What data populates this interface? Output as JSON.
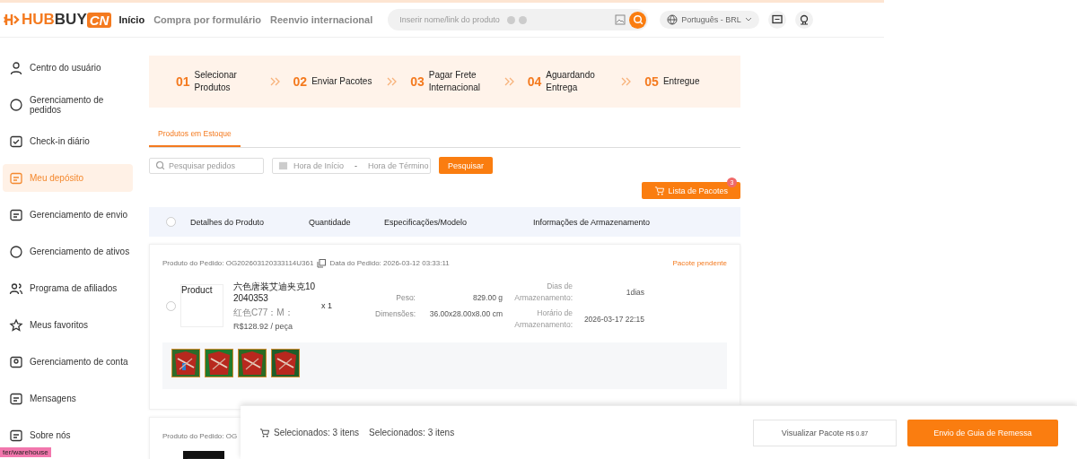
{
  "header": {
    "logo": {
      "first": "HUB",
      "second": "BUY",
      "badge": "CN"
    },
    "nav": [
      {
        "label": "Início",
        "selected": true
      },
      {
        "label": "Compra por formulário",
        "selected": false
      },
      {
        "label": "Reenvio internacional",
        "selected": false
      }
    ],
    "search": {
      "placeholder": "Inserir nome/link do produto"
    },
    "language": "Português - BRL"
  },
  "sidebar": {
    "items": [
      {
        "label": "Centro do usuário",
        "selected": false
      },
      {
        "label": "Gerenciamento de pedidos",
        "selected": false
      },
      {
        "label": "Check-in diário",
        "selected": false
      },
      {
        "label": "Meu depósito",
        "selected": true
      },
      {
        "label": "Gerenciamento de envio",
        "selected": false
      },
      {
        "label": "Gerenciamento de ativos",
        "selected": false
      },
      {
        "label": "Programa de afiliados",
        "selected": false
      },
      {
        "label": "Meus favoritos",
        "selected": false
      },
      {
        "label": "Gerenciamento de conta",
        "selected": false
      },
      {
        "label": "Mensagens",
        "selected": false
      },
      {
        "label": "Sobre nós",
        "selected": false
      }
    ]
  },
  "steps": [
    {
      "number": "01",
      "label": "Selecionar Produtos"
    },
    {
      "number": "02",
      "label": "Enviar Pacotes"
    },
    {
      "number": "03",
      "label": "Pagar Frete Internacional"
    },
    {
      "number": "04",
      "label": "Aguardando Entrega"
    },
    {
      "number": "05",
      "label": "Entregue"
    }
  ],
  "tabs": [
    {
      "label": "Produtos em Estoque",
      "selected": true
    }
  ],
  "filters": {
    "search_placeholder": "Pesquisar pedidos",
    "start_placeholder": "Hora de Início",
    "separator": "-",
    "end_placeholder": "Hora de Término",
    "button": "Pesquisar"
  },
  "package_list": {
    "label": "Lista de Pacotes",
    "badge": "3"
  },
  "table": {
    "select_all": false,
    "columns": [
      "Detalhes do Produto",
      "Quantidade",
      "Especificações/Modelo",
      "Informações de Armazenamento"
    ]
  },
  "orders": [
    {
      "order": "Produto do Pedido: OG202603120333114U361",
      "date": "Data do Pedido: 2026-03-12 03:33:11",
      "status": "Pacote pendente",
      "item": {
        "selected": false,
        "image_alt": "Product",
        "name": "六色唐装艾迪夹克102040353",
        "spec": "红色C77：M：",
        "price": "R$128.92 / peça",
        "quantity": "x 1",
        "weight_label": "Peso:",
        "weight": "829.00 g",
        "size_label": "Dimensões:",
        "size": "36.00x28.00x8.00 cm",
        "days_label": "Dias de Armazenamento:",
        "days": "1dias",
        "time_label": "Horário de Armazenamento:",
        "time": "2026-03-17 22:15"
      }
    },
    {
      "order": "Produto do Pedido: OG"
    }
  ],
  "bottom_bar": {
    "selected_1": "Selecionados: 3 itens",
    "selected_2": "Selecionados: 3 itens",
    "view_button": "Visualizar Pacote",
    "price": "R$ 0.87",
    "submit_button": "Envio de Guia de Remessa"
  },
  "status_url": "ter/warehouse"
}
